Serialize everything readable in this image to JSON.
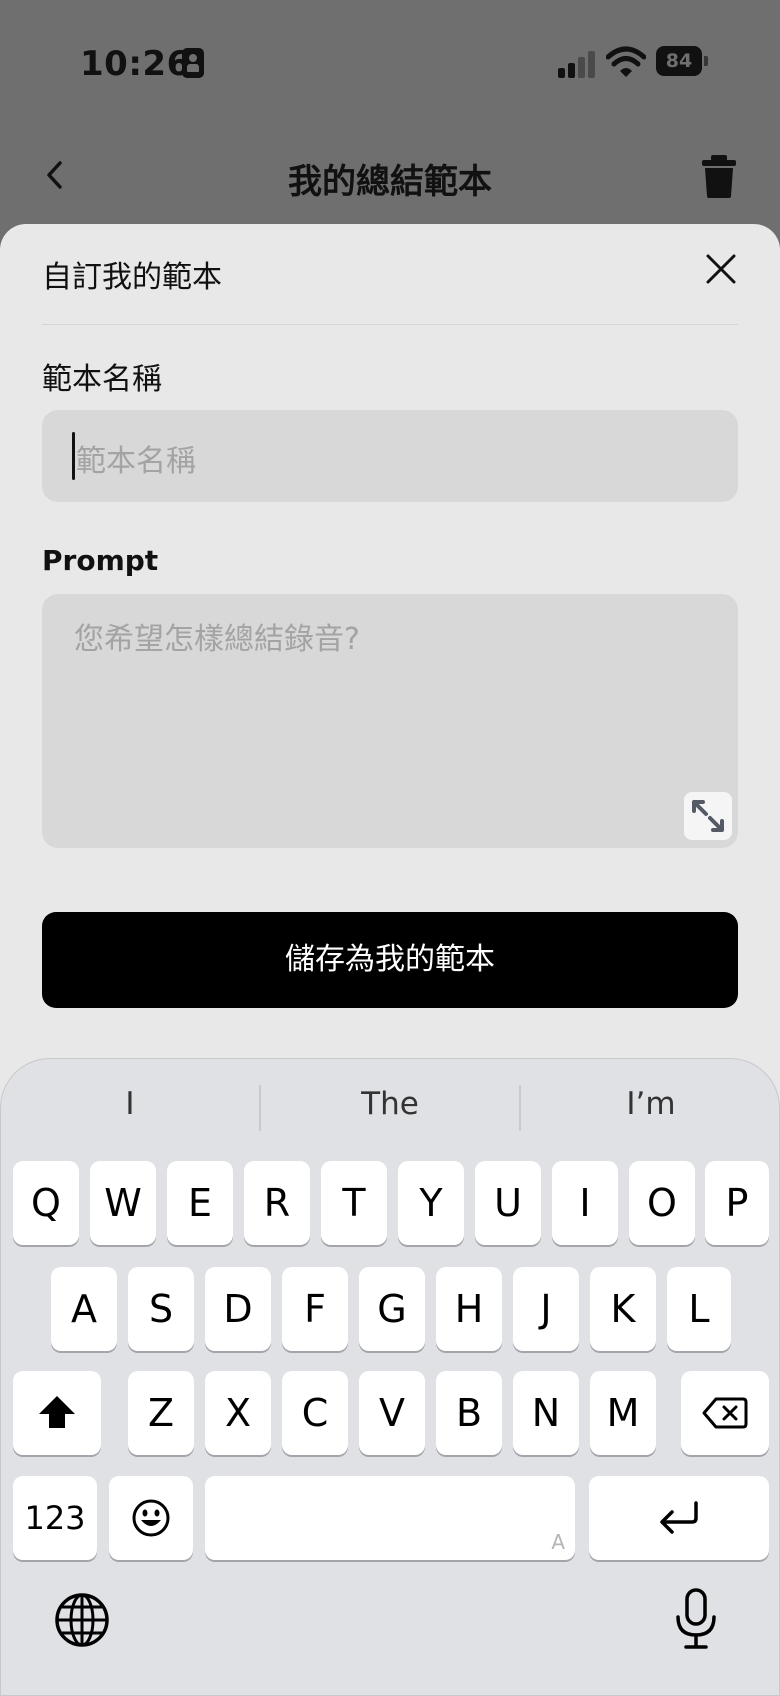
{
  "status_bar": {
    "time": "10:26",
    "battery": "84"
  },
  "nav": {
    "title": "我的總結範本"
  },
  "sheet": {
    "title": "自訂我的範本",
    "name_label": "範本名稱",
    "name_placeholder": "範本名稱",
    "prompt_label": "Prompt",
    "prompt_placeholder": "您希望怎樣總結錄音?",
    "save_label": "儲存為我的範本"
  },
  "keyboard": {
    "suggestions": [
      "I",
      "The",
      "I’m"
    ],
    "row1": [
      "Q",
      "W",
      "E",
      "R",
      "T",
      "Y",
      "U",
      "I",
      "O",
      "P"
    ],
    "row2": [
      "A",
      "S",
      "D",
      "F",
      "G",
      "H",
      "J",
      "K",
      "L"
    ],
    "row3": [
      "Z",
      "X",
      "C",
      "V",
      "B",
      "N",
      "M"
    ],
    "numbers_label": "123",
    "space_mark": "A"
  },
  "icons": [
    "back-icon",
    "trash-icon",
    "close-icon",
    "expand-icon",
    "shift-icon",
    "delete-icon",
    "emoji-icon",
    "return-icon",
    "globe-icon",
    "mic-icon"
  ]
}
